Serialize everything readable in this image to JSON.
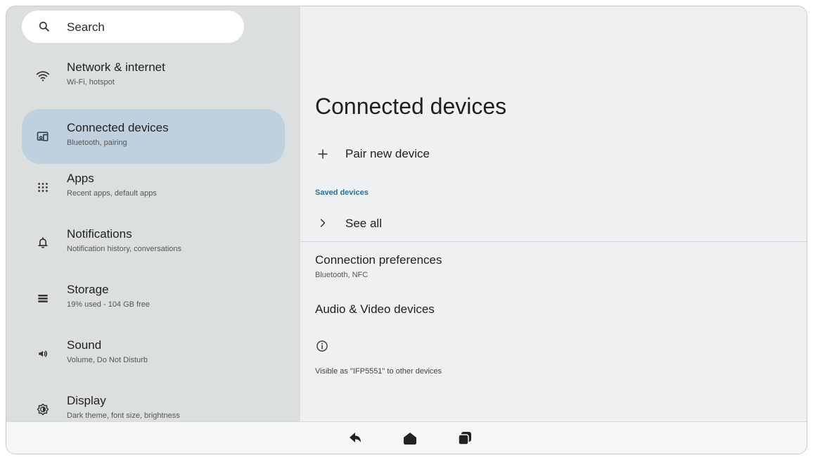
{
  "search": {
    "label": "Search",
    "icon": "search-icon"
  },
  "sidebar": {
    "items": [
      {
        "title": "Network & internet",
        "subtitle": "Wi-Fi, hotspot",
        "icon": "wifi-icon",
        "active": false
      },
      {
        "title": "Connected devices",
        "subtitle": "Bluetooth, pairing",
        "icon": "connected-devices-icon",
        "active": true
      },
      {
        "title": "Apps",
        "subtitle": "Recent apps, default apps",
        "icon": "apps-grid-icon",
        "active": false
      },
      {
        "title": "Notifications",
        "subtitle": "Notification history, conversations",
        "icon": "bell-icon",
        "active": false
      },
      {
        "title": "Storage",
        "subtitle": "19% used - 104 GB free",
        "icon": "storage-icon",
        "active": false
      },
      {
        "title": "Sound",
        "subtitle": "Volume, Do Not Disturb",
        "icon": "speaker-icon",
        "active": false
      },
      {
        "title": "Display",
        "subtitle": "Dark theme, font size, brightness",
        "icon": "display-brightness-icon",
        "active": false
      }
    ]
  },
  "main": {
    "title": "Connected devices",
    "pair_new_device": "Pair new device",
    "saved_devices_label": "Saved devices",
    "see_all": "See all",
    "connection_preferences": {
      "title": "Connection preferences",
      "subtitle": "Bluetooth, NFC"
    },
    "audio_video_devices": "Audio & Video devices",
    "visible_as": "Visible as \"IFP5551\" to other devices"
  },
  "navbar": {
    "buttons": [
      "back-icon",
      "home-icon",
      "recents-icon"
    ]
  },
  "colors": {
    "sidebar_bg": "#dcdfe0",
    "active_item_bg": "#bfd1de",
    "main_bg": "#eef0f2",
    "section_label": "#2a6f96"
  }
}
